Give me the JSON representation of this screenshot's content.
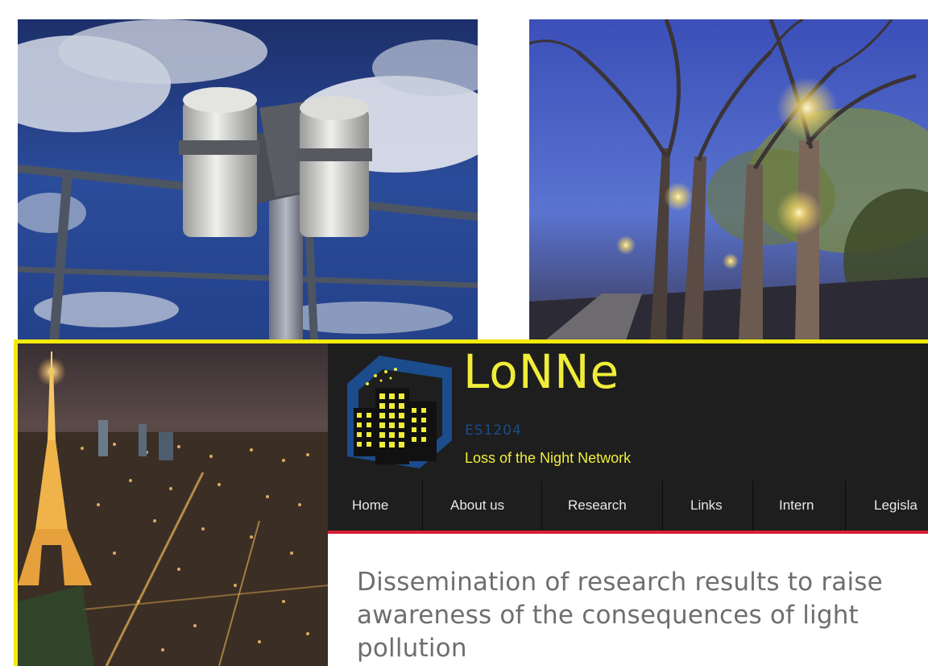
{
  "photos": {
    "sensor": {
      "description_icon": "sky-quality-sensor-photo"
    },
    "trees": {
      "description_icon": "street-lights-trees-photo"
    },
    "paris": {
      "description_icon": "paris-night-skyline-photo"
    }
  },
  "site": {
    "logo": {
      "title": "LoNNe",
      "code": "ES1204",
      "tagline": "Loss of the Night Network"
    },
    "nav": {
      "items": [
        {
          "label": "Home"
        },
        {
          "label": "About us"
        },
        {
          "label": "Research"
        },
        {
          "label": "Links"
        },
        {
          "label": "Intern"
        },
        {
          "label": "Legisla"
        }
      ]
    },
    "headline": "Dissemination of research results to raise awareness of the consequences of light pollution"
  },
  "colors": {
    "highlight_border": "#f2ea0c",
    "logo_yellow": "#f0ed3a",
    "logo_blue": "#1b4c8c",
    "header_bg": "#1e1e1e",
    "nav_accent": "#d81e36",
    "headline_text": "#6e6e6e"
  }
}
